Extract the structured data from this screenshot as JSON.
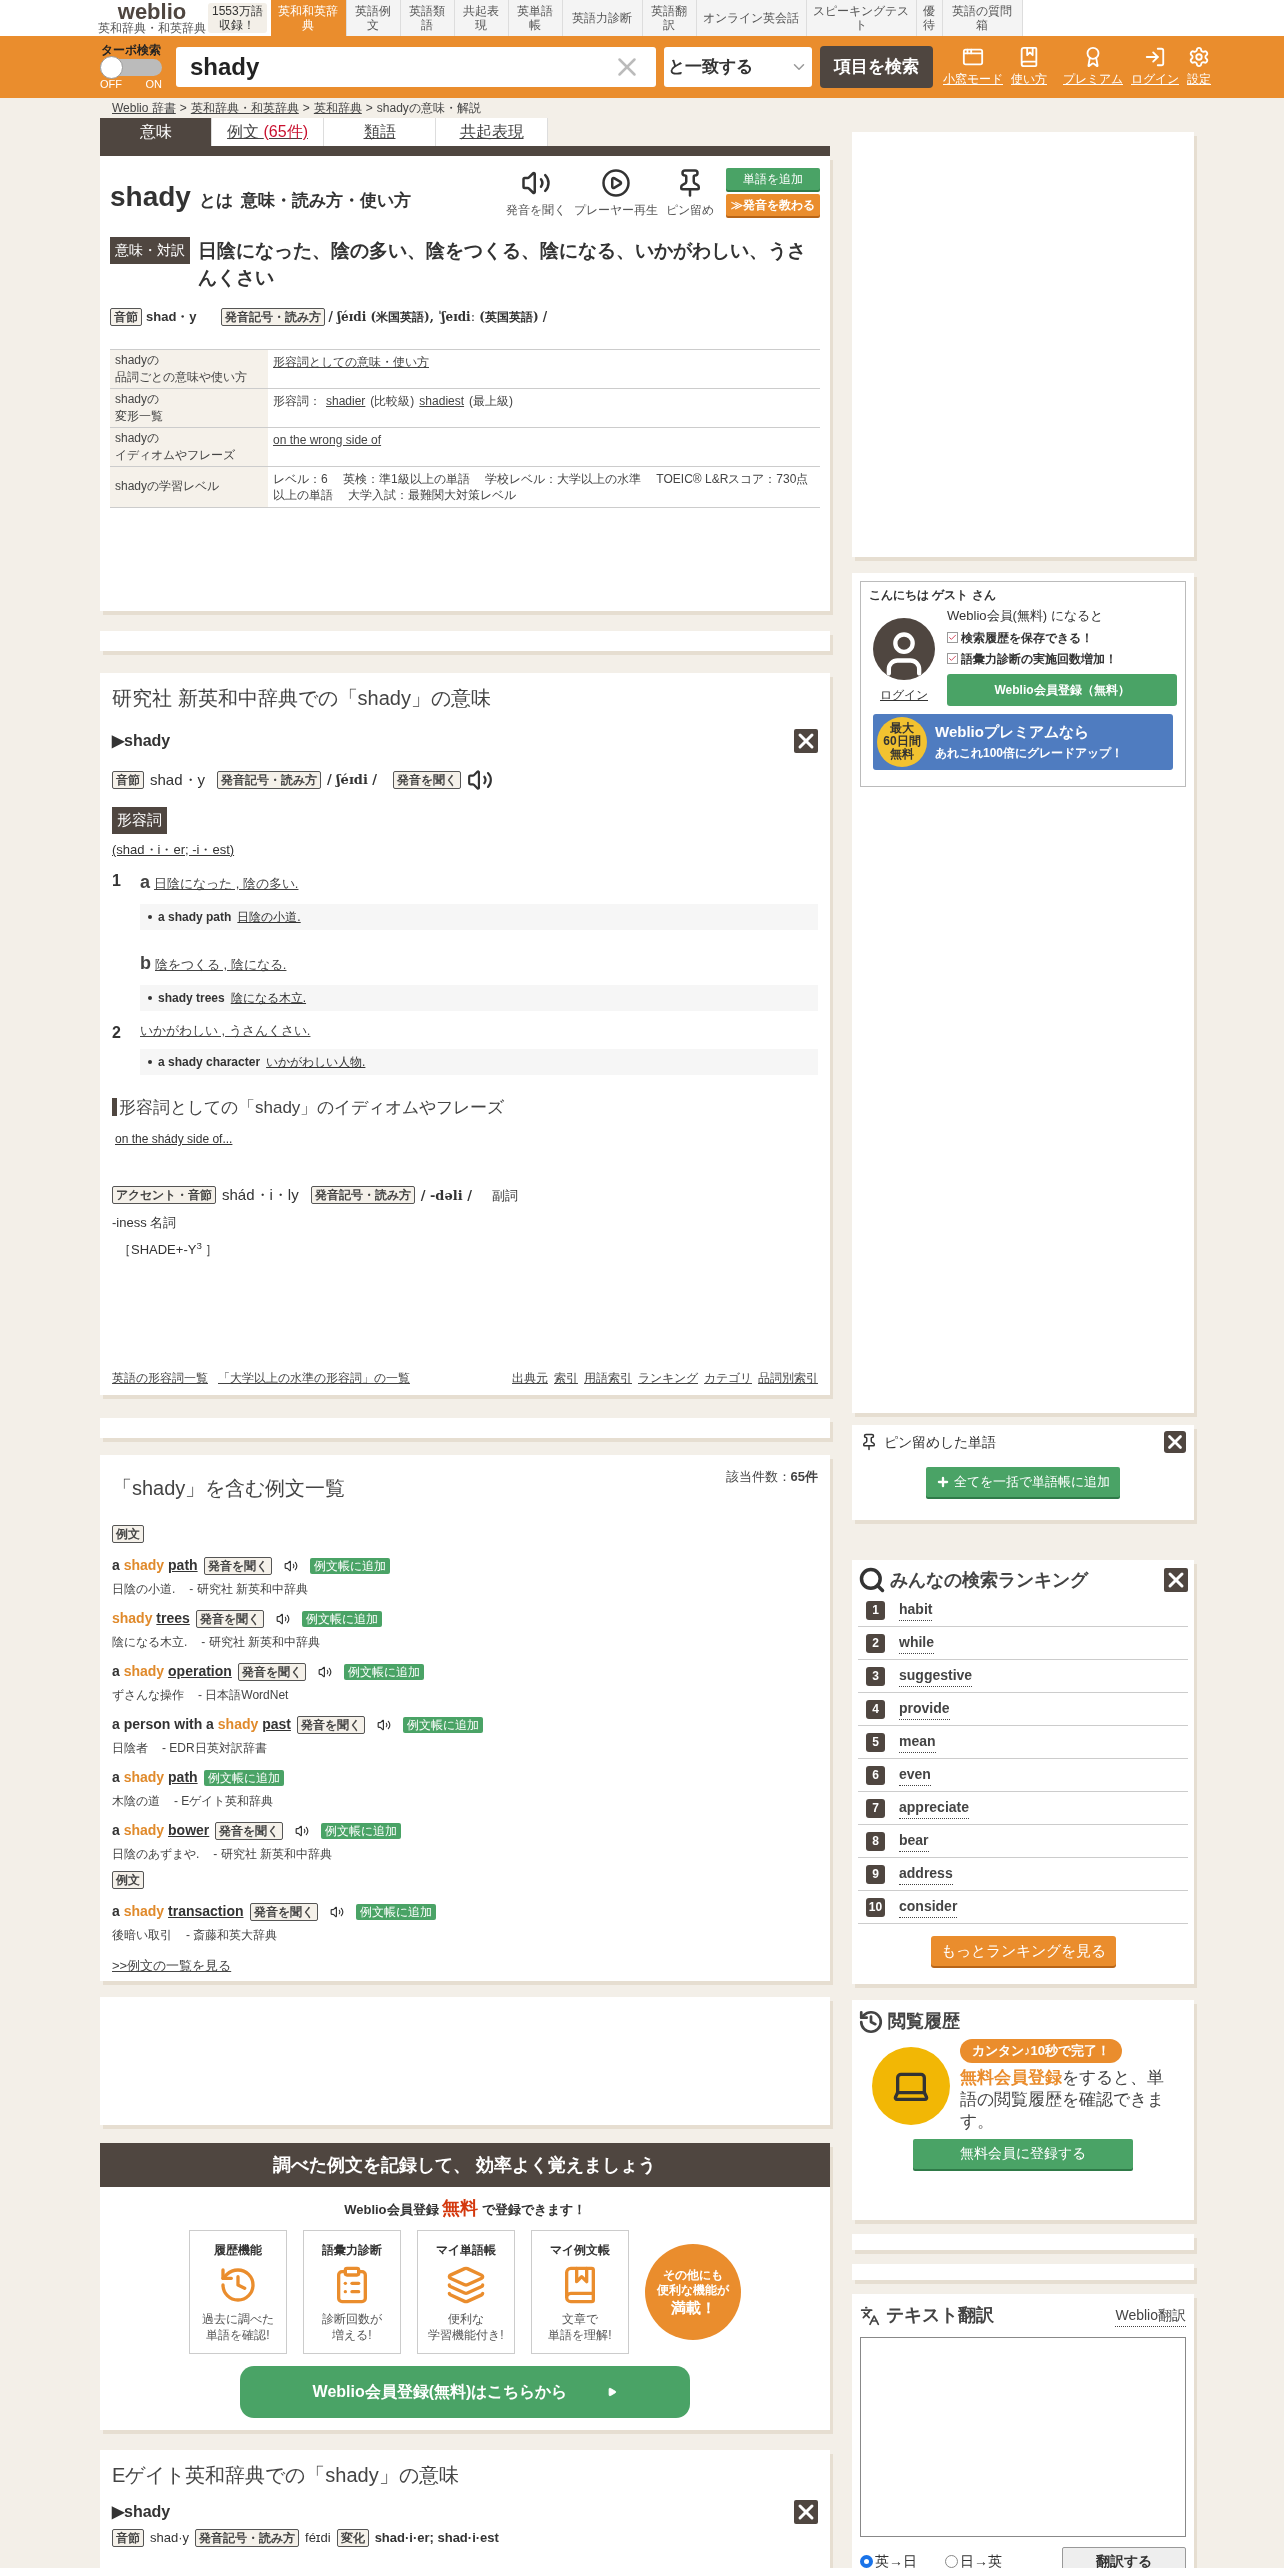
{
  "header": {
    "logo": "weblio",
    "logo_sub": "英和辞典・和英辞典",
    "badge": [
      "1553万語",
      "収録！"
    ],
    "nav": [
      {
        "label": "英和和英辞典",
        "selected": true
      },
      {
        "label": "英語例文",
        "selected": false
      },
      {
        "label": "英語類語",
        "selected": false
      },
      {
        "label": "共起表現",
        "selected": false
      },
      {
        "label": "英単語帳",
        "selected": false
      },
      {
        "label": "英語力診断",
        "selected": false
      },
      {
        "label": "英語翻訳",
        "selected": false
      },
      {
        "label": "オンライン英会話",
        "selected": false
      },
      {
        "label": "スピーキングテスト",
        "selected": false
      },
      {
        "label": "優待",
        "selected": false
      },
      {
        "label": "英語の質問箱",
        "selected": false
      }
    ]
  },
  "search": {
    "turbo_label": "ターボ検索",
    "turbo_on": false,
    "off_label": "OFF",
    "on_label": "ON",
    "query": "shady",
    "match": "と一致する",
    "button": "項目を検索",
    "tools": [
      {
        "kind": "window",
        "label": "小窓モード"
      },
      {
        "kind": "guide",
        "label": "使い方"
      },
      {
        "kind": "premium",
        "label": "プレミアム"
      },
      {
        "kind": "login",
        "label": "ログイン"
      },
      {
        "kind": "settings",
        "label": "設定"
      }
    ]
  },
  "breadcrumb": {
    "separator": ">",
    "items": [
      {
        "label": "Weblio 辞書",
        "link": true
      },
      {
        "label": "英和辞典・和英辞典",
        "link": true
      },
      {
        "label": "英和辞典",
        "link": true
      },
      {
        "label": "shadyの意味・解説",
        "link": false
      }
    ]
  },
  "tabs": [
    {
      "label": "意味",
      "selected": true
    },
    {
      "label": "例文",
      "count": "(65件)",
      "selected": false
    },
    {
      "label": "類語",
      "selected": false
    },
    {
      "label": "共起表現",
      "selected": false
    }
  ],
  "entry": {
    "word": "shady",
    "suffix": "とは",
    "subtitle": "意味・読み方・使い方",
    "actions": [
      {
        "kind": "speaker",
        "label": "発音を聞く"
      },
      {
        "kind": "play",
        "label": "プレーヤー再生"
      },
      {
        "kind": "pin",
        "label": "ピン留め"
      }
    ],
    "add_button": "単語を追加",
    "learn_button": "≫発音を教わる",
    "meaning_label": "意味・対訳",
    "meaning": "日陰になった、陰の多い、陰をつくる、陰になる、いかがわしい、うさんくさい",
    "syllable_label": "音節",
    "syllable": "shad・y",
    "pron_label": "発音記号・読み方",
    "pron": "/ ʃéɪdi (米国英語), ˈʃeɪdiː (英国英語) /",
    "rows": [
      {
        "header": [
          "shadyの",
          "品詞ごとの意味や使い方"
        ],
        "content": [
          {
            "text": "形容詞としての意味・使い方",
            "link": true
          }
        ]
      },
      {
        "header": [
          "shadyの",
          "変形一覧"
        ],
        "content": [
          {
            "text": "形容詞：",
            "link": false
          },
          {
            "text": "shadier",
            "link": true
          },
          {
            "text": "(比較級)",
            "link": false
          },
          {
            "text": "shadiest",
            "link": true
          },
          {
            "text": "(最上級)",
            "link": false
          }
        ]
      },
      {
        "header": [
          "shadyの",
          "イディオムやフレーズ"
        ],
        "content": [
          {
            "text": "on the wrong side of",
            "link": true
          }
        ]
      },
      {
        "header": [
          "shadyの学習レベル"
        ],
        "content": [
          {
            "text": "レベル：6　 英検：準1級以上の単語　 学校レベル：大学以上の水準　 TOEIC® L&Rスコア：730点以上の単語　 大学入試：最難関大対策レベル",
            "link": false
          }
        ]
      }
    ]
  },
  "kenkyusha": {
    "title": "研究社 新英和中辞典での「shady」の意味",
    "arrow": "▶",
    "headword": "shady",
    "syllable_label": "音節",
    "syllable": "shad・y",
    "pron_label": "発音記号・読み方",
    "pron": "/ ʃéɪdi /",
    "listen_label": "発音を聞く",
    "pos": "形容詞",
    "inflection": "(shad・i・er; -i・est)",
    "senses": [
      {
        "num": "1",
        "subs": [
          {
            "letter": "a",
            "gloss": "日陰になった , 陰の多い.",
            "example_en": "a shady path",
            "example_ja": "日陰の小道."
          },
          {
            "letter": "b",
            "gloss": "陰をつくる , 陰になる.",
            "example_en": "shady trees",
            "example_ja": "陰になる木立."
          }
        ]
      },
      {
        "num": "2",
        "subs": [
          {
            "gloss": "いかがわしい , うさんくさい.",
            "example_en": "a shady character",
            "example_ja": "いかがわしい人物."
          }
        ]
      }
    ],
    "idiom_heading": "形容詞としての「shady」のイディオムやフレーズ",
    "idiom": "on the shády side of...",
    "derived_accent_label": "アクセント・音節",
    "derived": "shád・i・ly",
    "derived_pron_label": "発音記号・読み方",
    "derived_pron": "/ -dəli /",
    "derived_pos": "副詞",
    "noun": "-iness 名詞",
    "etym": "［SHADE+-Y$^{3}$ ］",
    "footer_left": [
      "英語の形容詞一覧",
      "「大学以上の水準の形容詞」の一覧"
    ],
    "footer_right": [
      "出典元",
      "索引",
      "用語索引",
      "ランキング",
      "カテゴリ",
      "品詞別索引"
    ]
  },
  "examples": {
    "title": "「shady」を含む例文一覧",
    "count_label": "該当件数：",
    "count": "65件",
    "items": [
      {
        "kind": "label",
        "text": "例文"
      },
      {
        "kind": "example",
        "pre": "a ",
        "hl": "shady",
        "post": "path",
        "listen": true,
        "listen_label": "発音を聞く",
        "add_label": "例文帳に追加",
        "ja": "日陰の小道.",
        "source": "- 研究社 新英和中辞典"
      },
      {
        "kind": "example",
        "hl": "shady",
        "post": "trees",
        "listen": true,
        "listen_label": "発音を聞く",
        "add_label": "例文帳に追加",
        "ja": "陰になる木立.",
        "source": "- 研究社 新英和中辞典"
      },
      {
        "kind": "example",
        "pre": "a ",
        "hl": "shady",
        "post": "operation",
        "listen": true,
        "listen_label": "発音を聞く",
        "add_label": "例文帳に追加",
        "ja": "ずさんな操作",
        "source": "- 日本語WordNet"
      },
      {
        "kind": "example",
        "pre": "a person with a ",
        "hl": "shady",
        "post": "past",
        "listen": true,
        "listen_label": "発音を聞く",
        "add_label": "例文帳に追加",
        "ja": "日陰者",
        "source": "- EDR日英対訳辞書"
      },
      {
        "kind": "example",
        "pre": "a ",
        "hl": "shady",
        "post": "path",
        "listen": false,
        "add_label": "例文帳に追加",
        "ja": "木陰の道",
        "source": "- Eゲイト英和辞典"
      },
      {
        "kind": "example",
        "pre": "a ",
        "hl": "shady",
        "post": "bower",
        "listen": true,
        "listen_label": "発音を聞く",
        "add_label": "例文帳に追加",
        "ja": "日陰のあずまや.",
        "source": "- 研究社 新英和中辞典"
      },
      {
        "kind": "label",
        "text": "例文"
      },
      {
        "kind": "example",
        "pre": "a ",
        "hl": "shady",
        "post": "transaction",
        "listen": true,
        "listen_label": "発音を聞く",
        "add_label": "例文帳に追加",
        "ja": "後暗い取引",
        "source": "- 斎藤和英大辞典"
      }
    ],
    "more": ">>例文の一覧を見る"
  },
  "promo": {
    "banner": "調べた例文を記録して、 効率よく覚えましょう",
    "sub_pre": "Weblio会員登録",
    "sub_em": "無料",
    "sub_post": "で登録できます！",
    "features": [
      {
        "kind": "history",
        "title": "履歴機能",
        "desc": [
          "過去に調べた",
          "単語を確認!"
        ]
      },
      {
        "kind": "diagnose",
        "title": "語彙力診断",
        "desc": [
          "診断回数が",
          "増える!"
        ]
      },
      {
        "kind": "cards",
        "title": "マイ単語帳",
        "desc": [
          "便利な",
          "学習機能付き!"
        ]
      },
      {
        "kind": "book",
        "title": "マイ例文帳",
        "desc": [
          "文章で",
          "単語を理解!"
        ]
      }
    ],
    "circle": [
      "その他にも",
      "便利な機能が",
      "満載！"
    ],
    "button": "Weblio会員登録(無料)はこちらから"
  },
  "egate": {
    "title": "Eゲイト英和辞典での「shady」の意味",
    "arrow": "▶",
    "headword": "shady",
    "syllable_label": "音節",
    "syllable": "shad·y",
    "pron_label": "発音記号・読み方",
    "pron": "féɪdi",
    "change_label": "変化",
    "change": "shad·i·er; shad·i·est"
  },
  "login_box": {
    "greeting": "こんにちは ゲスト さん",
    "login": "ログイン",
    "member_line": "Weblio会員(無料) になると",
    "benefits": [
      "検索履歴を保存できる！",
      "語彙力診断の実施回数増加！"
    ],
    "register": "Weblio会員登録（無料）",
    "premium_badge": [
      "最大",
      "60日間",
      "無料"
    ],
    "premium_title": "Weblioプレミアムなら",
    "premium_sub": "あれこれ100倍にグレードアップ！"
  },
  "pinned": {
    "title": "ピン留めした単語",
    "button": "全てを一括で単語帳に追加"
  },
  "ranking": {
    "title": "みんなの検索ランキング",
    "items": [
      {
        "rank": "1",
        "word": "habit"
      },
      {
        "rank": "2",
        "word": "while"
      },
      {
        "rank": "3",
        "word": "suggestive"
      },
      {
        "rank": "4",
        "word": "provide"
      },
      {
        "rank": "5",
        "word": "mean"
      },
      {
        "rank": "6",
        "word": "even"
      },
      {
        "rank": "7",
        "word": "appreciate"
      },
      {
        "rank": "8",
        "word": "bear"
      },
      {
        "rank": "9",
        "word": "address"
      },
      {
        "rank": "10",
        "word": "consider"
      }
    ],
    "more": "もっとランキングを見る"
  },
  "history": {
    "title": "閲覧履歴",
    "bubble": "カンタン♪10秒で完了！",
    "em": "無料会員登録",
    "text": "をすると、単語の閲覧履歴を確認できます。",
    "button": "無料会員に登録する"
  },
  "translate": {
    "title": "テキスト翻訳",
    "link": "Weblio翻訳",
    "options": [
      {
        "label": "英→日",
        "selected": true
      },
      {
        "label": "日→英",
        "selected": false
      }
    ],
    "button": "翻訳する"
  }
}
